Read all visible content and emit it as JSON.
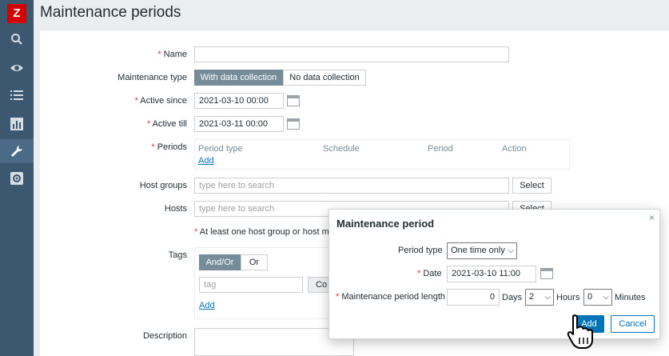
{
  "app": {
    "logo_letter": "Z"
  },
  "page": {
    "title": "Maintenance periods"
  },
  "sidebar": {
    "items": [
      {
        "icon": "search-icon"
      },
      {
        "icon": "eye-icon"
      },
      {
        "icon": "list-icon"
      },
      {
        "icon": "chart-icon"
      },
      {
        "icon": "wrench-icon"
      },
      {
        "icon": "gear-icon"
      }
    ]
  },
  "form": {
    "name": {
      "label": "Name",
      "value": ""
    },
    "maintenance_type": {
      "label": "Maintenance type",
      "options": [
        "With data collection",
        "No data collection"
      ],
      "selected": "With data collection"
    },
    "active_since": {
      "label": "Active since",
      "value": "2021-03-10 00:00"
    },
    "active_till": {
      "label": "Active till",
      "value": "2021-03-11 00:00"
    },
    "periods": {
      "label": "Periods",
      "columns": [
        "Period type",
        "Schedule",
        "Period",
        "Action"
      ],
      "add_link": "Add"
    },
    "host_groups": {
      "label": "Host groups",
      "placeholder": "type here to search",
      "select_button": "Select"
    },
    "hosts": {
      "label": "Hosts",
      "placeholder": "type here to search",
      "select_button": "Select"
    },
    "hint": "At least one host group or host mu",
    "tags": {
      "label": "Tags",
      "options": [
        "And/Or",
        "Or"
      ],
      "selected": "And/Or",
      "tag_placeholder": "tag",
      "contains_button": "Co",
      "add_link": "Add"
    },
    "description": {
      "label": "Description"
    }
  },
  "modal": {
    "title": "Maintenance period",
    "close": "×",
    "period_type": {
      "label": "Period type",
      "value": "One time only"
    },
    "date": {
      "label": "Date",
      "value": "2021-03-10 11:00"
    },
    "length": {
      "label": "Maintenance period length",
      "days": "0",
      "days_unit": "Days",
      "hours": "2",
      "hours_unit": "Hours",
      "minutes": "0",
      "minutes_unit": "Minutes"
    },
    "add_button": "Add",
    "cancel_button": "Cancel"
  },
  "colors": {
    "sidebar": "#3c5770",
    "accent": "#0275b8",
    "required": "#e33734",
    "logo": "#d40000"
  }
}
